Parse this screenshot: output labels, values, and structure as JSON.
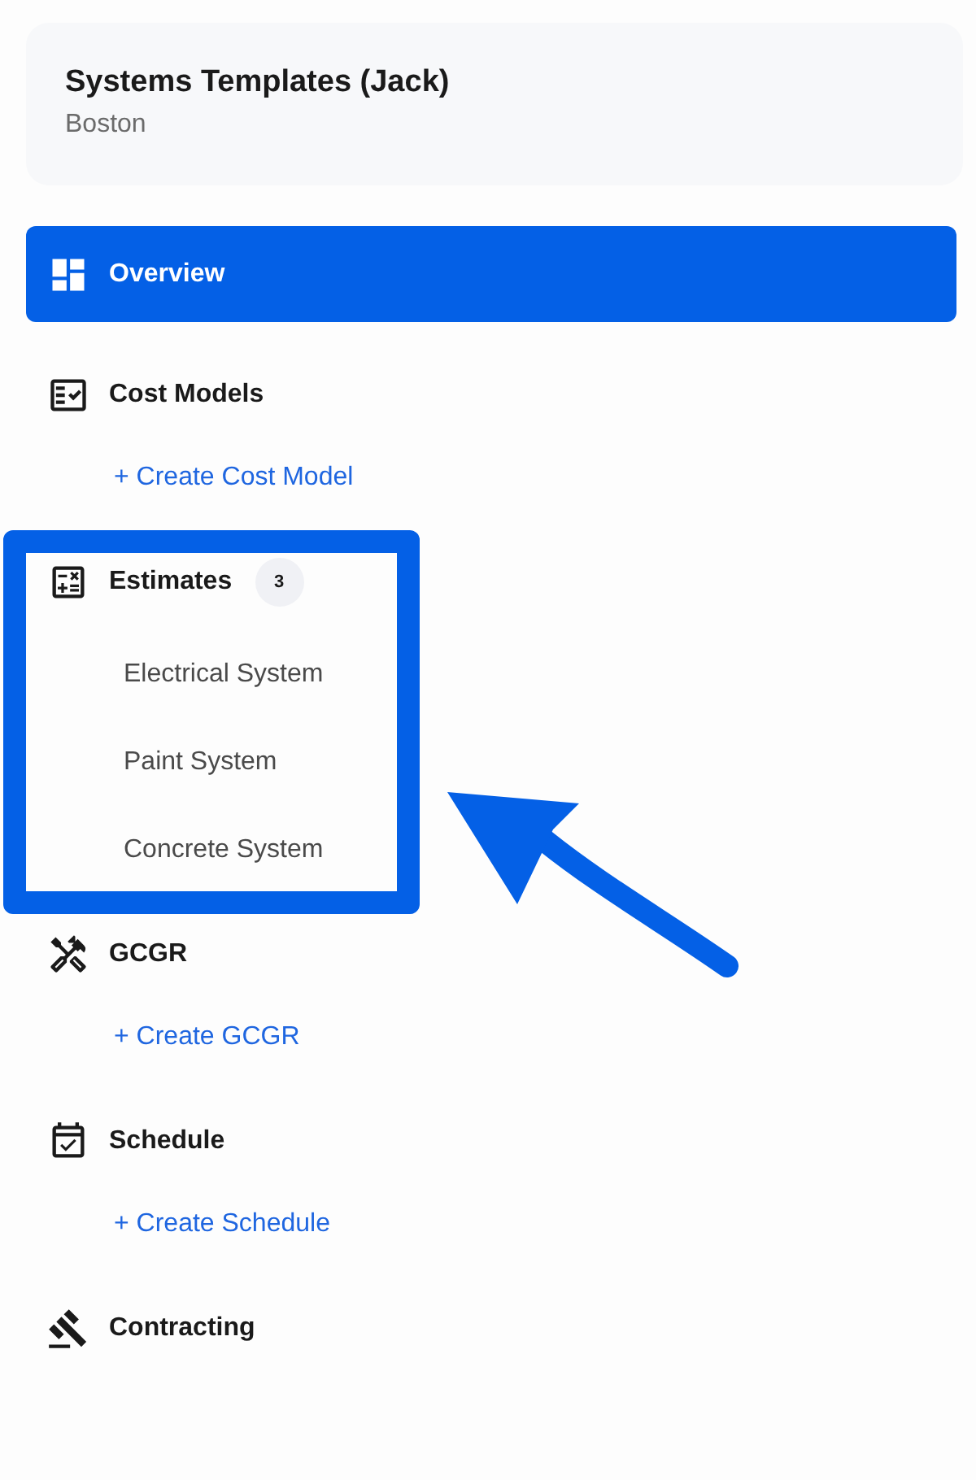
{
  "project": {
    "name": "Systems Templates (Jack)",
    "location": "Boston"
  },
  "nav": [
    {
      "label": "Overview",
      "selected": true
    },
    {
      "label": "Cost Models",
      "selected": false,
      "action": "+ Create Cost Model"
    },
    {
      "label": "Estimates",
      "selected": false,
      "badge": "3",
      "children": [
        {
          "label": "Electrical System"
        },
        {
          "label": "Paint System"
        },
        {
          "label": "Concrete System"
        }
      ]
    },
    {
      "label": "GCGR",
      "selected": false,
      "action": "+ Create GCGR"
    },
    {
      "label": "Schedule",
      "selected": false,
      "action": "+ Create Schedule"
    },
    {
      "label": "Contracting",
      "selected": false
    }
  ]
}
